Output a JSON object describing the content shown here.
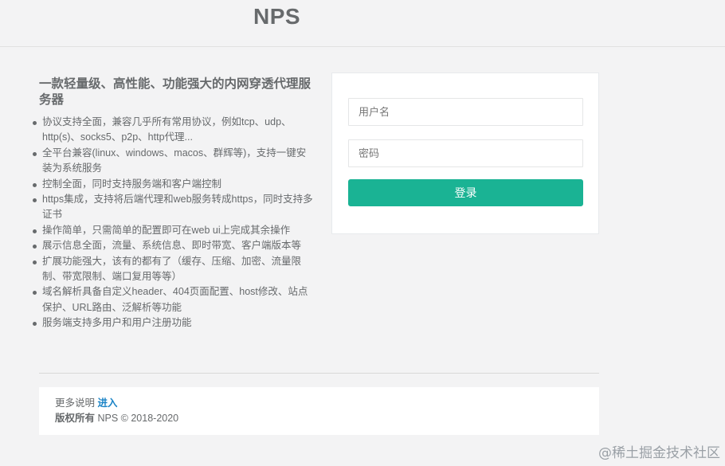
{
  "header": {
    "brand": "NPS"
  },
  "intro": {
    "headline": "一款轻量级、高性能、功能强大的内网穿透代理服务器",
    "features": [
      "协议支持全面，兼容几乎所有常用协议，例如tcp、udp、http(s)、socks5、p2p、http代理...",
      "全平台兼容(linux、windows、macos、群辉等)，支持一键安装为系统服务",
      "控制全面，同时支持服务端和客户端控制",
      "https集成，支持将后端代理和web服务转成https，同时支持多证书",
      "操作简单，只需简单的配置即可在web ui上完成其余操作",
      "展示信息全面，流量、系统信息、即时带宽、客户端版本等",
      "扩展功能强大，该有的都有了（缓存、压缩、加密、流量限制、带宽限制、端口复用等等）",
      "域名解析具备自定义header、404页面配置、host修改、站点保护、URL路由、泛解析等功能",
      "服务端支持多用户和用户注册功能"
    ]
  },
  "login": {
    "username_placeholder": "用户名",
    "username_value": "",
    "password_placeholder": "密码",
    "password_value": "",
    "submit_label": "登录"
  },
  "footer": {
    "more_label": "更多说明",
    "more_link": "进入",
    "copyright_label": "版权所有",
    "copyright_text": "NPS © 2018-2020"
  },
  "watermark": "@稀土掘金技术社区",
  "colors": {
    "accent": "#1ab394",
    "link": "#1c84c6",
    "text": "#676a6c",
    "background": "#f3f3f4"
  }
}
